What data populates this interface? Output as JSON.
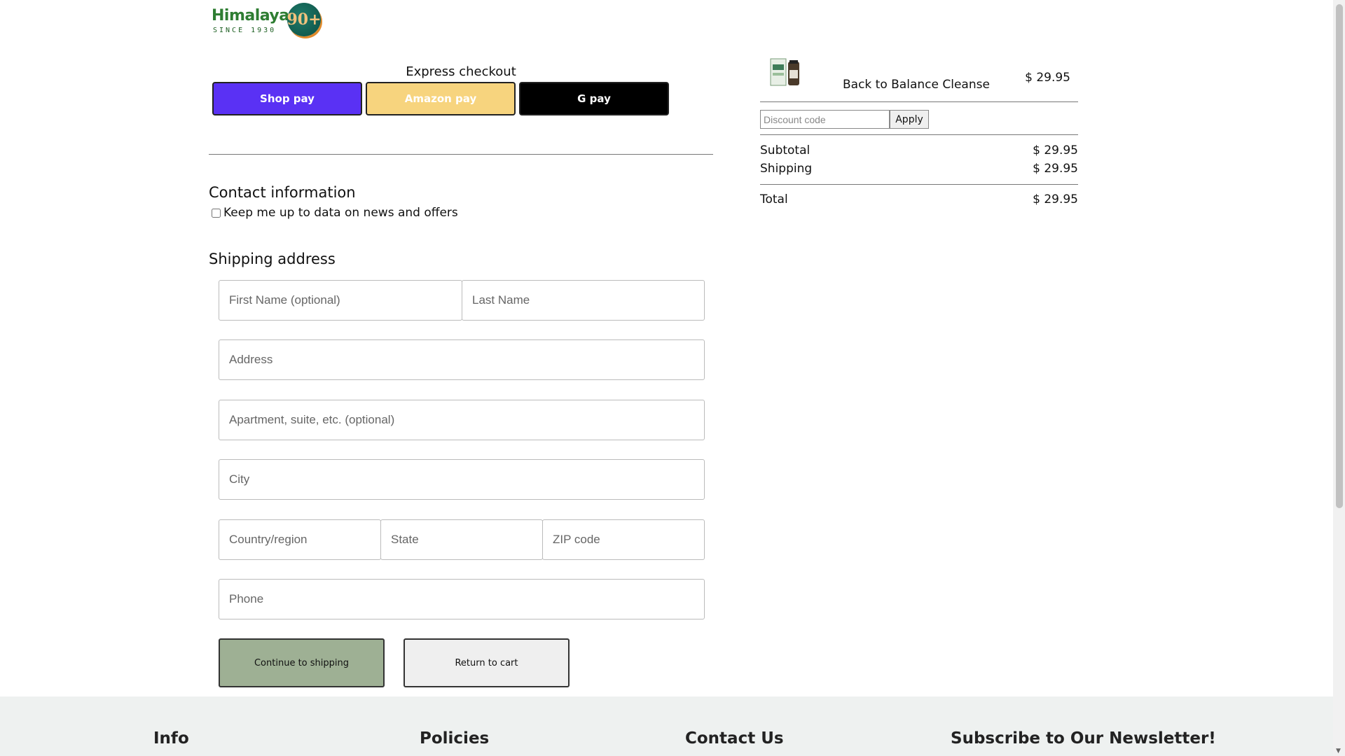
{
  "brand": {
    "logo_text": "Himalaya",
    "logo_since": "SINCE 1930",
    "badge_text": "90+"
  },
  "express": {
    "title": "Express checkout",
    "shop_pay": "Shop pay",
    "amazon_pay": "Amazon pay",
    "g_pay": "G pay"
  },
  "contact": {
    "title": "Contact information",
    "newsletter_label": "Keep me up to data on news and offers"
  },
  "shipping": {
    "title": "Shipping address",
    "first_name": "First Name (optional)",
    "last_name": "Last Name",
    "address": "Address",
    "apartment": "Apartment, suite, etc. (optional)",
    "city": "City",
    "country": "Country/region",
    "state": "State",
    "zip": "ZIP code",
    "phone": "Phone"
  },
  "actions": {
    "continue": "Continue to shipping",
    "return": "Return to cart"
  },
  "summary": {
    "product_name": "Back to Balance Cleanse",
    "product_price": "$ 29.95",
    "discount_placeholder": "Discount code",
    "apply": "Apply",
    "subtotal_label": "Subtotal",
    "subtotal_value": "$ 29.95",
    "shipping_label": "Shipping",
    "shipping_value": "$ 29.95",
    "total_label": "Total",
    "total_value": "$ 29.95"
  },
  "footer": {
    "info": "Info",
    "policies": "Policies",
    "contact": "Contact Us",
    "newsletter": "Subscribe to Our Newsletter!"
  },
  "colors": {
    "shop_pay": "#5a31f4",
    "amazon_pay": "#f7d47e",
    "g_pay": "#000000",
    "continue_button": "#9eb094",
    "footer_bg": "#eef1f0"
  }
}
